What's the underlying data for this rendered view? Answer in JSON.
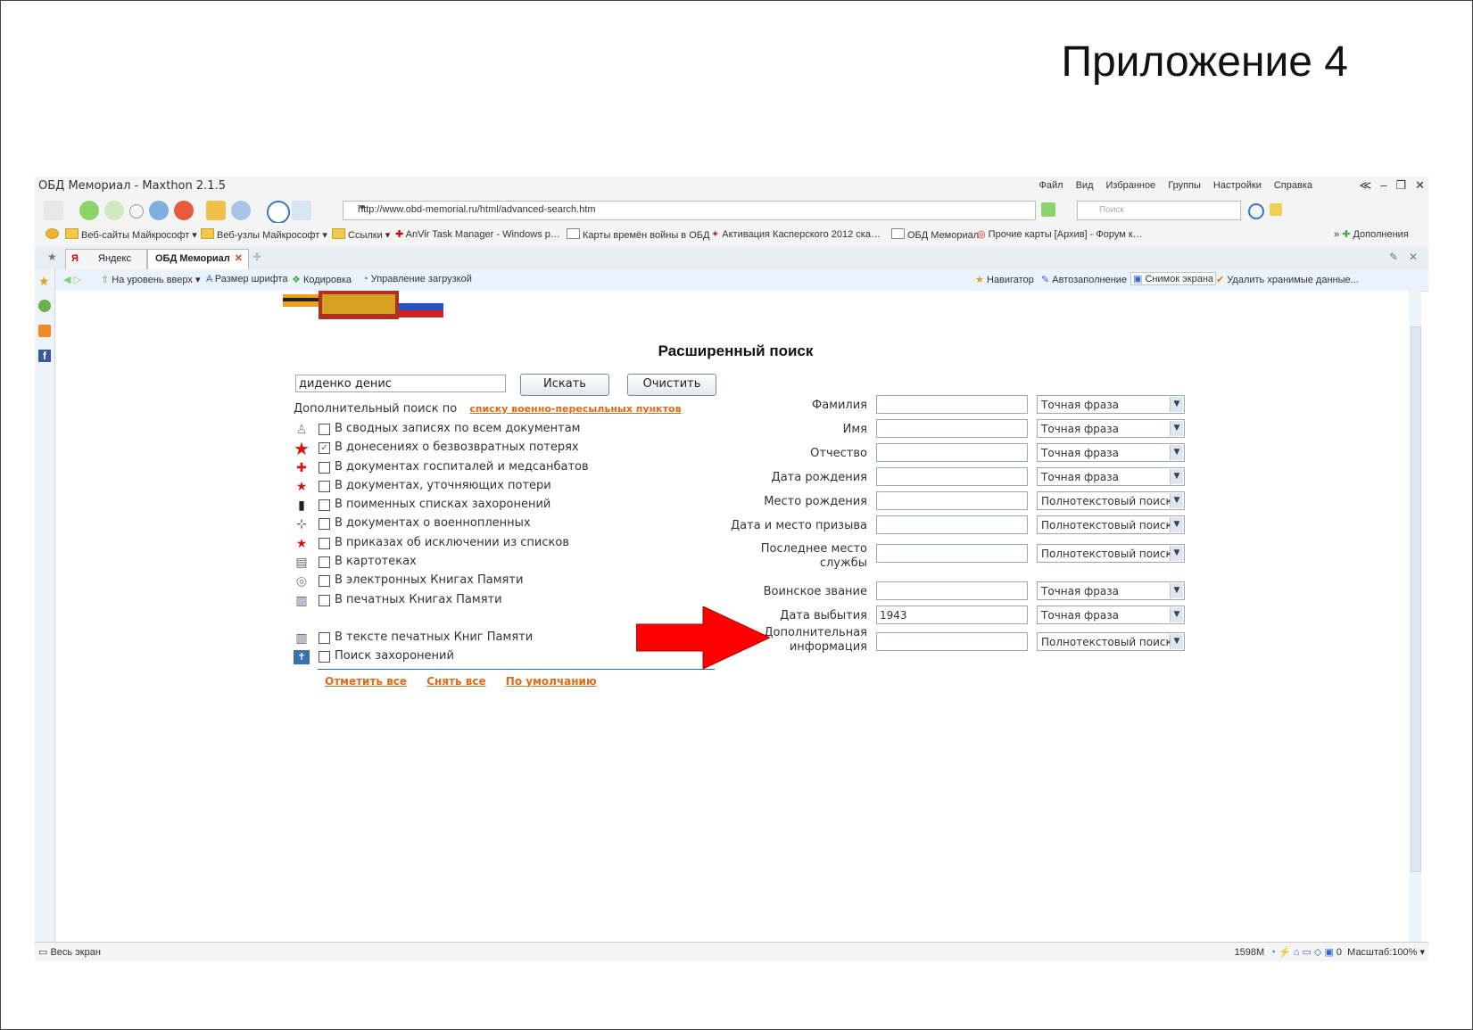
{
  "slide": {
    "title": "Приложение 4"
  },
  "browser": {
    "title": "ОБД Мемориал - Maxthon 2.1.5",
    "menu": [
      "Файл",
      "Вид",
      "Избранное",
      "Группы",
      "Настройки",
      "Справка"
    ],
    "url": "http://www.obd-memorial.ru/html/advanced-search.htm",
    "search_placeholder": "Поиск",
    "favorites": [
      "Веб-сайты Майкрософт",
      "Веб-узлы Майкрософт",
      "Ссылки",
      "AnVir Task Manager - Windows p…",
      "Карты времён войны в ОБД",
      "Активация Касперского 2012 ска…",
      "ОБД Мемориал",
      "Прочие карты [Архив] - Форум к…"
    ],
    "addons_label": "Дополнения",
    "tabs": [
      "Яндекс",
      "ОБД Мемориал"
    ],
    "page_tools_left": [
      "На уровень вверх",
      "Размер шрифта",
      "Кодировка",
      "Управление загрузкой"
    ],
    "page_tools_right": [
      "Навигатор",
      "Автозаполнение",
      "Снимок экрана",
      "Удалить хранимые данные..."
    ],
    "status_left": "Весь экран",
    "status_memory": "1598M",
    "status_count": "0",
    "status_zoom": "Масштаб:100%"
  },
  "page": {
    "heading": "Расширенный поиск",
    "query_value": "диденко денис",
    "search_button": "Искать",
    "clear_button": "Очистить",
    "extra_search_label": "Дополнительный поиск по",
    "extra_search_link": "списку военно-пересыльных пунктов",
    "sources": [
      {
        "label": "В сводных записях по всем документам",
        "checked": false,
        "icon": "soldier-icon"
      },
      {
        "label": "В донесениях о безвозвратных потерях",
        "checked": true,
        "icon": "red-star-icon"
      },
      {
        "label": "В документах госпиталей и медсанбатов",
        "checked": false,
        "icon": "red-cross-icon"
      },
      {
        "label": "В документах, уточняющих потери",
        "checked": false,
        "icon": "star-plus-icon"
      },
      {
        "label": "В поименных списках захоронений",
        "checked": false,
        "icon": "obelisk-icon"
      },
      {
        "label": "В документах о военнопленных",
        "checked": false,
        "icon": "barbed-wire-icon"
      },
      {
        "label": "В приказах об исключении из списков",
        "checked": false,
        "icon": "star-minus-icon"
      },
      {
        "label": "В картотеках",
        "checked": false,
        "icon": "card-index-icon"
      },
      {
        "label": "В электронных Книгах Памяти",
        "checked": false,
        "icon": "ebook-icon"
      },
      {
        "label": "В печатных Книгах Памяти",
        "checked": false,
        "icon": "printed-book-icon"
      },
      {
        "label": "В тексте печатных Книг Памяти",
        "checked": false,
        "icon": "book-text-icon"
      },
      {
        "label": "Поиск захоронений",
        "checked": false,
        "icon": "burial-icon"
      }
    ],
    "links": [
      "Отметить все",
      "Снять все",
      "По умолчанию"
    ],
    "fields": [
      {
        "label": "Фамилия",
        "value": "",
        "mode": "Точная фраза"
      },
      {
        "label": "Имя",
        "value": "",
        "mode": "Точная фраза"
      },
      {
        "label": "Отчество",
        "value": "",
        "mode": "Точная фраза"
      },
      {
        "label": "Дата рождения",
        "value": "",
        "mode": "Точная фраза"
      },
      {
        "label": "Место рождения",
        "value": "",
        "mode": "Полнотекстовый поиск"
      },
      {
        "label": "Дата и место призыва",
        "value": "",
        "mode": "Полнотекстовый поиск"
      },
      {
        "label": "Последнее место службы",
        "value": "",
        "mode": "Полнотекстовый поиск"
      },
      {
        "label": "Воинское звание",
        "value": "",
        "mode": "Точная фраза"
      },
      {
        "label": "Дата выбытия",
        "value": "1943",
        "mode": "Точная фраза"
      },
      {
        "label": "Дополнительная информация",
        "value": "",
        "mode": "Полнотекстовый поиск"
      }
    ]
  },
  "colors": {
    "link_orange": "#e06a1a",
    "arrow_red": "#ff0000",
    "accent_blue": "#2b6f9a"
  }
}
